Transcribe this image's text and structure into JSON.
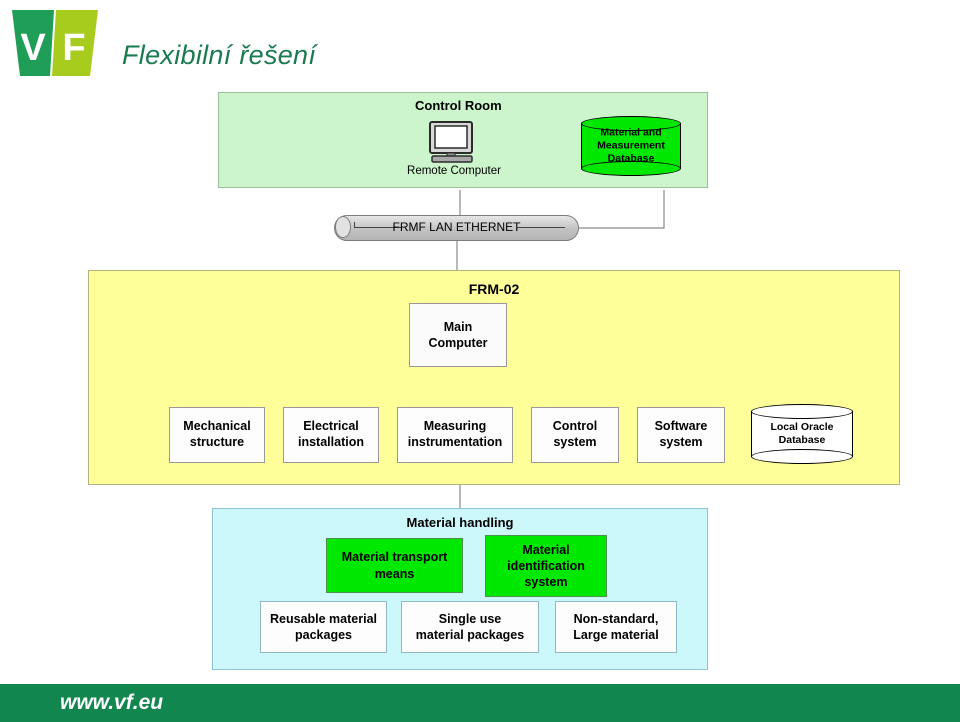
{
  "brand": {
    "logo_letters": [
      "V",
      "F"
    ],
    "logo_colors": {
      "left": "#1e9e57",
      "right": "#a8cc1e"
    },
    "title": "Flexibilní řešení",
    "title_color": "#1a7a50",
    "footer_url": "www.vf.eu",
    "footer_color": "#12864f"
  },
  "diagram": {
    "control_room": {
      "title": "Control Room",
      "panel_color": "#ccf5cc",
      "remote_computer": {
        "label": "Remote Computer",
        "icon": "crt-monitor-icon"
      },
      "database": {
        "label": "Material and Measurement Database",
        "lines": [
          "Material and",
          "Measurement",
          "Database"
        ],
        "color": "#00e800",
        "shape": "cylinder"
      }
    },
    "network_bus": {
      "label": "FRMF LAN ETHERNET",
      "shape": "cylinder-bus",
      "color": "#c2c2c2"
    },
    "frm02": {
      "title": "FRM-02",
      "panel_color": "#ffff99",
      "main_node": {
        "label": "Main Computer",
        "lines": [
          "Main",
          "Computer"
        ]
      },
      "children": [
        {
          "label": "Mechanical structure",
          "lines": [
            "Mechanical",
            "structure"
          ],
          "shape": "box"
        },
        {
          "label": "Electrical installation",
          "lines": [
            "Electrical",
            "installation"
          ],
          "shape": "box"
        },
        {
          "label": "Measuring instrumentation",
          "lines": [
            "Measuring",
            "instrumentation"
          ],
          "shape": "box"
        },
        {
          "label": "Control system",
          "lines": [
            "Control",
            "system"
          ],
          "shape": "box"
        },
        {
          "label": "Software system",
          "lines": [
            "Software",
            "system"
          ],
          "shape": "box"
        },
        {
          "label": "Local Oracle Database",
          "lines": [
            "Local Oracle",
            "Database"
          ],
          "shape": "cylinder"
        }
      ]
    },
    "material_handling": {
      "title": "Material handling",
      "panel_color": "#ccf7fb",
      "green_nodes": [
        {
          "label": "Material transport means",
          "lines": [
            "Material transport",
            "means"
          ]
        },
        {
          "label": "Material identification system",
          "lines": [
            "Material",
            "identification",
            "system"
          ]
        }
      ],
      "package_nodes": [
        {
          "label": "Reusable material packages",
          "lines": [
            "Reusable material",
            "packages"
          ]
        },
        {
          "label": "Single use material packages",
          "lines": [
            "Single use",
            "material packages"
          ]
        },
        {
          "label": "Non-standard, Large material",
          "lines": [
            "Non-standard,",
            "Large material"
          ]
        }
      ]
    }
  }
}
